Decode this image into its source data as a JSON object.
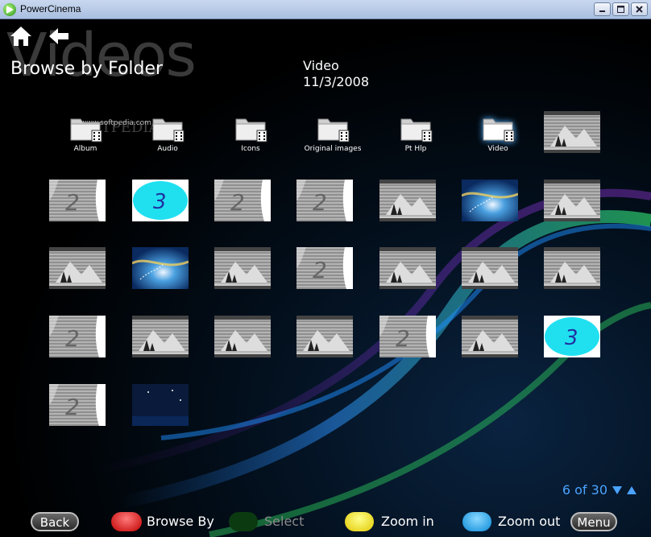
{
  "window": {
    "title": "PowerCinema",
    "buttons": [
      "minimize",
      "maximize",
      "close"
    ]
  },
  "header": {
    "big_title": "Videos",
    "subtitle": "Browse by Folder",
    "selected_name": "Video",
    "selected_date": "11/3/2008"
  },
  "folders": [
    {
      "label": "Album",
      "selected": false
    },
    {
      "label": "Audio",
      "selected": false
    },
    {
      "label": "Icons",
      "selected": false
    },
    {
      "label": "Original images",
      "selected": false
    },
    {
      "label": "Pt Hlp",
      "selected": false
    },
    {
      "label": "Video",
      "selected": true
    }
  ],
  "watermark": {
    "brand": "SOFTPEDIA",
    "url": "www.softpedia.com"
  },
  "thumbnails": [
    "film",
    "two",
    "three",
    "two",
    "two",
    "film",
    "photo",
    "film",
    "film",
    "photo",
    "film",
    "two",
    "film",
    "film",
    "film",
    "two",
    "film",
    "film",
    "film",
    "two",
    "film",
    "three",
    "two",
    "night"
  ],
  "pager": {
    "text": "6 of 30"
  },
  "footer": {
    "back": "Back",
    "browse_by": "Browse By",
    "select": "Select",
    "zoom_in": "Zoom in",
    "zoom_out": "Zoom out",
    "menu": "Menu",
    "colors": {
      "red": "#e01010",
      "green": "#0b3a10",
      "yellow": "#f2e000",
      "blue": "#18a4f0"
    }
  }
}
